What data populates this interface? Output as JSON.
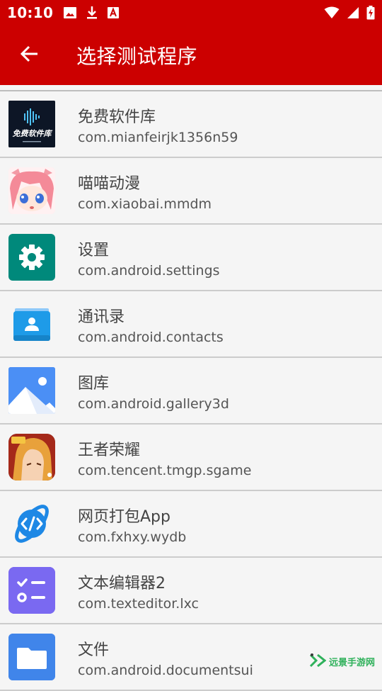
{
  "status_bar": {
    "time": "10:10",
    "left_icons": [
      "image-icon",
      "download-icon",
      "font-icon"
    ],
    "right_icons": [
      "wifi-icon",
      "signal-icon",
      "battery-charging-icon"
    ],
    "color": "#cc0000"
  },
  "app_bar": {
    "title": "选择测试程序",
    "back_icon": "arrow-back-icon",
    "color": "#cc0000"
  },
  "apps": [
    {
      "name": "免费软件库",
      "package": "com.mianfeirjk1356n59",
      "icon": "free-software-library-icon",
      "icon_text": "免费软件库"
    },
    {
      "name": "喵喵动漫",
      "package": "com.xiaobai.mmdm",
      "icon": "anime-girl-icon"
    },
    {
      "name": "设置",
      "package": "com.android.settings",
      "icon": "settings-gear-icon"
    },
    {
      "name": "通讯录",
      "package": "com.android.contacts",
      "icon": "contacts-icon"
    },
    {
      "name": "图库",
      "package": "com.android.gallery3d",
      "icon": "gallery-icon"
    },
    {
      "name": "王者荣耀",
      "package": "com.tencent.tmgp.sgame",
      "icon": "game-hero-icon"
    },
    {
      "name": "网页打包App",
      "package": "com.fxhxy.wydb",
      "icon": "code-brackets-icon"
    },
    {
      "name": "文本编辑器2",
      "package": "com.texteditor.lxc",
      "icon": "checklist-icon"
    },
    {
      "name": "文件",
      "package": "com.android.documentsui",
      "icon": "folder-icon"
    }
  ],
  "watermark": {
    "text": "远景手游网"
  }
}
